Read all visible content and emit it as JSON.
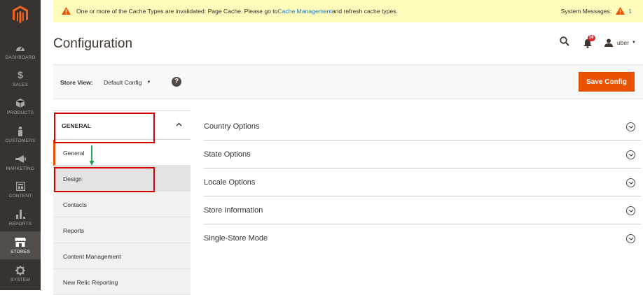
{
  "sidebar": {
    "items": [
      {
        "label": "DASHBOARD",
        "icon": "dashboard-icon"
      },
      {
        "label": "SALES",
        "icon": "dollar-icon",
        "glyph": "$"
      },
      {
        "label": "PRODUCTS",
        "icon": "box-icon"
      },
      {
        "label": "CUSTOMERS",
        "icon": "person-icon"
      },
      {
        "label": "MARKETING",
        "icon": "megaphone-icon"
      },
      {
        "label": "CONTENT",
        "icon": "content-icon"
      },
      {
        "label": "REPORTS",
        "icon": "bar-chart-icon"
      },
      {
        "label": "STORES",
        "icon": "store-icon",
        "active": true
      },
      {
        "label": "SYSTEM",
        "icon": "gear-icon"
      }
    ]
  },
  "notice": {
    "text_before": "One or more of the Cache Types are invalidated: Page Cache. Please go to ",
    "link": "Cache Management",
    "text_after": " and refresh cache types.",
    "system_messages_label": "System Messages:",
    "system_messages_count": "1"
  },
  "header": {
    "title": "Configuration",
    "notifications_count": "18",
    "username": "uber"
  },
  "store_view": {
    "label": "Store View:",
    "value": "Default Config",
    "help": "?",
    "save_label": "Save Config"
  },
  "config_nav": {
    "tab": "GENERAL",
    "items": [
      "General",
      "Design",
      "Contacts",
      "Reports",
      "Content Management",
      "New Relic Reporting"
    ]
  },
  "sections": [
    "Country Options",
    "State Options",
    "Locale Options",
    "Store Information",
    "Single-Store Mode"
  ],
  "colors": {
    "accent": "#eb5202",
    "sidebar_bg": "#373330",
    "notice_bg": "#fffbbb",
    "link": "#1979c3",
    "highlight": "#d40000",
    "arrow": "#1aa34a"
  }
}
